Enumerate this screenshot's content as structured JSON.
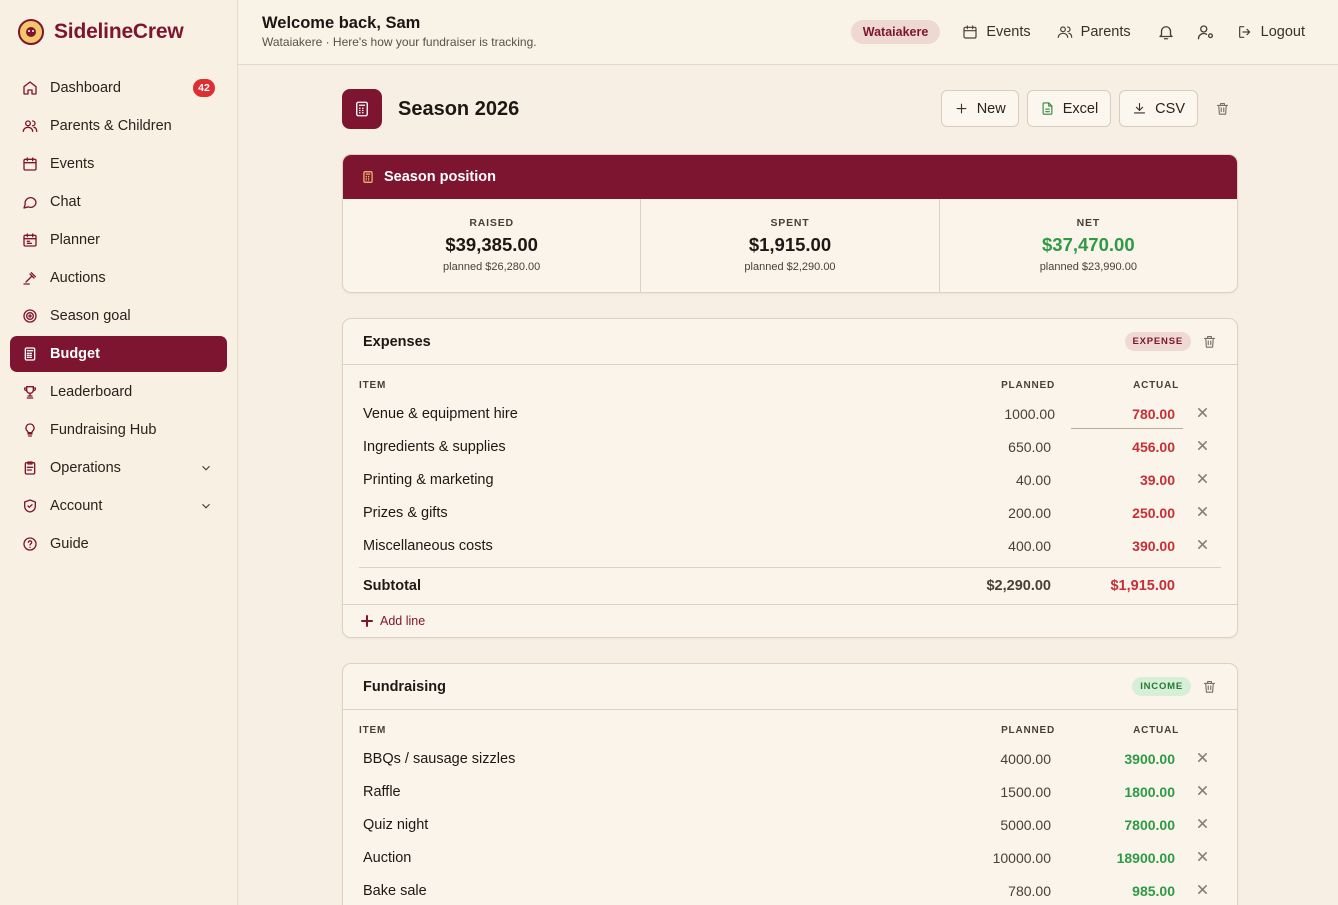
{
  "brand": {
    "name": "SidelineCrew"
  },
  "sidebar": {
    "items": [
      {
        "label": "Dashboard",
        "badge": "42",
        "icon": "home-icon"
      },
      {
        "label": "Parents & Children",
        "icon": "users-icon"
      },
      {
        "label": "Events",
        "icon": "calendar-icon"
      },
      {
        "label": "Chat",
        "icon": "chat-icon"
      },
      {
        "label": "Planner",
        "icon": "planner-icon"
      },
      {
        "label": "Auctions",
        "icon": "gavel-icon"
      },
      {
        "label": "Season goal",
        "icon": "target-icon"
      },
      {
        "label": "Budget",
        "icon": "calculator-icon",
        "active": true
      },
      {
        "label": "Leaderboard",
        "icon": "trophy-icon"
      },
      {
        "label": "Fundraising Hub",
        "icon": "lightbulb-icon"
      },
      {
        "label": "Operations",
        "icon": "clipboard-icon",
        "expandable": true
      },
      {
        "label": "Account",
        "icon": "shield-icon",
        "expandable": true
      },
      {
        "label": "Guide",
        "icon": "help-icon"
      }
    ]
  },
  "topbar": {
    "welcome_title": "Welcome back, Sam",
    "welcome_sub": "Wataiakere · Here's how your fundraiser is tracking.",
    "org": "Wataiakere",
    "events_label": "Events",
    "parents_label": "Parents",
    "logout_label": "Logout"
  },
  "page": {
    "title": "Season 2026",
    "new_label": "New",
    "excel_label": "Excel",
    "csv_label": "CSV"
  },
  "position": {
    "title": "Season position",
    "raised": {
      "label": "RAISED",
      "value": "$39,385.00",
      "planned": "planned $26,280.00"
    },
    "spent": {
      "label": "SPENT",
      "value": "$1,915.00",
      "planned": "planned $2,290.00"
    },
    "net": {
      "label": "NET",
      "value": "$37,470.00",
      "planned": "planned $23,990.00"
    }
  },
  "expenses": {
    "title": "Expenses",
    "type": "EXPENSE",
    "headers": {
      "item": "ITEM",
      "planned": "PLANNED",
      "actual": "ACTUAL"
    },
    "rows": [
      {
        "item": "Venue & equipment hire",
        "planned": "1000.00",
        "actual": "780.00"
      },
      {
        "item": "Ingredients & supplies",
        "planned": "650.00",
        "actual": "456.00"
      },
      {
        "item": "Printing & marketing",
        "planned": "40.00",
        "actual": "39.00"
      },
      {
        "item": "Prizes & gifts",
        "planned": "200.00",
        "actual": "250.00"
      },
      {
        "item": "Miscellaneous costs",
        "planned": "400.00",
        "actual": "390.00"
      }
    ],
    "subtotal": {
      "label": "Subtotal",
      "planned": "$2,290.00",
      "actual": "$1,915.00"
    },
    "add_line": "Add line"
  },
  "fundraising": {
    "title": "Fundraising",
    "type": "INCOME",
    "headers": {
      "item": "ITEM",
      "planned": "PLANNED",
      "actual": "ACTUAL"
    },
    "rows": [
      {
        "item": "BBQs / sausage sizzles",
        "planned": "4000.00",
        "actual": "3900.00"
      },
      {
        "item": "Raffle",
        "planned": "1500.00",
        "actual": "1800.00"
      },
      {
        "item": "Quiz night",
        "planned": "5000.00",
        "actual": "7800.00"
      },
      {
        "item": "Auction",
        "planned": "10000.00",
        "actual": "18900.00"
      },
      {
        "item": "Bake sale",
        "planned": "780.00",
        "actual": "985.00"
      }
    ]
  },
  "colors": {
    "brand": "#7e1530",
    "expense": "#c62f37",
    "income": "#2f9a46",
    "background": "#f7efe3"
  }
}
